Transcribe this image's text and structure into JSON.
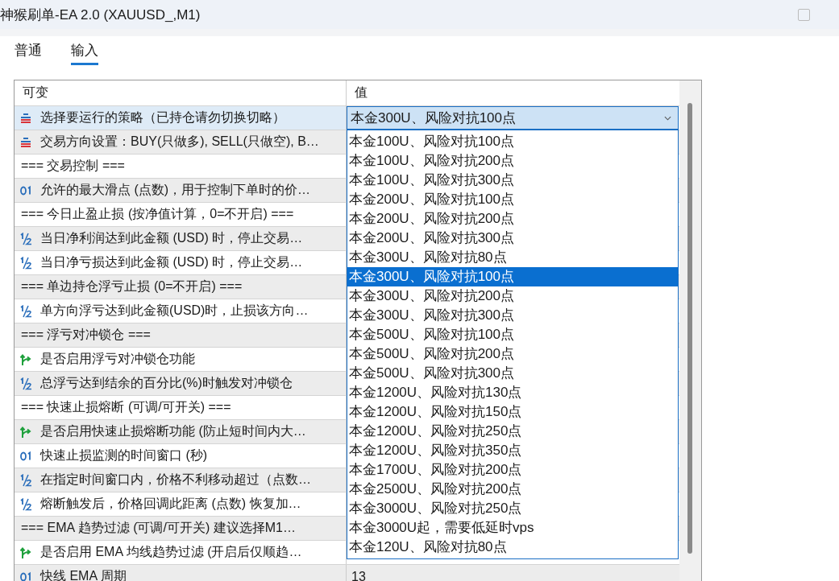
{
  "window": {
    "title": "神猴刷单-EA 2.0 (XAUUSD_,M1)"
  },
  "tabs": [
    {
      "label": "普通",
      "selected": false
    },
    {
      "label": "输入",
      "selected": true
    }
  ],
  "table": {
    "columns": [
      "可变",
      "值"
    ],
    "rows": [
      {
        "kind": "enum",
        "name": "选择要运行的策略（已持仓请勿切换切略）",
        "selected": true,
        "value": "本金300U、风险对抗100点"
      },
      {
        "kind": "enum",
        "name": "交易方向设置：BUY(只做多), SELL(只做空), B…",
        "selected": false
      },
      {
        "kind": "section",
        "name": "=== 交易控制 ===",
        "selected": false
      },
      {
        "kind": "int",
        "name": "允许的最大滑点 (点数)，用于控制下单时的价…",
        "selected": false
      },
      {
        "kind": "section",
        "name": "=== 今日止盈止损 (按净值计算，0=不开启) ===",
        "selected": false
      },
      {
        "kind": "double",
        "name": "当日净利润达到此金额 (USD) 时，停止交易…",
        "selected": false
      },
      {
        "kind": "double",
        "name": "当日净亏损达到此金额 (USD) 时，停止交易…",
        "selected": false
      },
      {
        "kind": "section",
        "name": "=== 单边持仓浮亏止损 (0=不开启) ===",
        "selected": false
      },
      {
        "kind": "double",
        "name": "单方向浮亏达到此金额(USD)时，止损该方向…",
        "selected": false
      },
      {
        "kind": "section",
        "name": "=== 浮亏对冲锁仓 ===",
        "selected": false
      },
      {
        "kind": "bool",
        "name": "是否启用浮亏对冲锁仓功能",
        "selected": false
      },
      {
        "kind": "double",
        "name": "总浮亏达到结余的百分比(%)时触发对冲锁仓",
        "selected": false
      },
      {
        "kind": "section",
        "name": "=== 快速止损熔断 (可调/可开关) ===",
        "selected": false
      },
      {
        "kind": "bool",
        "name": "是否启用快速止损熔断功能 (防止短时间内大…",
        "selected": false
      },
      {
        "kind": "int",
        "name": "快速止损监测的时间窗口 (秒)",
        "selected": false
      },
      {
        "kind": "double",
        "name": "在指定时间窗口内，价格不利移动超过（点数…",
        "selected": false
      },
      {
        "kind": "double",
        "name": "熔断触发后，价格回调此距离 (点数) 恢复加…",
        "selected": false
      },
      {
        "kind": "section",
        "name": "===  EMA 趋势过滤 (可调/可开关) 建议选择M1…",
        "selected": false
      },
      {
        "kind": "bool",
        "name": "是否启用 EMA 均线趋势过滤 (开启后仅顺趋…",
        "selected": false
      },
      {
        "kind": "int",
        "name": "快线 EMA 周期",
        "selected": false,
        "value": "13"
      }
    ]
  },
  "dropdown": {
    "options": [
      {
        "label": "本金100U、风险对抗100点",
        "selected": false
      },
      {
        "label": "本金100U、风险对抗200点",
        "selected": false
      },
      {
        "label": "本金100U、风险对抗300点",
        "selected": false
      },
      {
        "label": "本金200U、风险对抗100点",
        "selected": false
      },
      {
        "label": "本金200U、风险对抗200点",
        "selected": false
      },
      {
        "label": "本金200U、风险对抗300点",
        "selected": false
      },
      {
        "label": "本金300U、风险对抗80点",
        "selected": false
      },
      {
        "label": "本金300U、风险对抗100点",
        "selected": true
      },
      {
        "label": "本金300U、风险对抗200点",
        "selected": false
      },
      {
        "label": "本金300U、风险对抗300点",
        "selected": false
      },
      {
        "label": "本金500U、风险对抗100点",
        "selected": false
      },
      {
        "label": "本金500U、风险对抗200点",
        "selected": false
      },
      {
        "label": "本金500U、风险对抗300点",
        "selected": false
      },
      {
        "label": "本金1200U、风险对抗130点",
        "selected": false
      },
      {
        "label": "本金1200U、风险对抗150点",
        "selected": false
      },
      {
        "label": "本金1200U、风险对抗250点",
        "selected": false
      },
      {
        "label": "本金1200U、风险对抗350点",
        "selected": false
      },
      {
        "label": "本金1700U、风险对抗200点",
        "selected": false
      },
      {
        "label": "本金2500U、风险对抗200点",
        "selected": false
      },
      {
        "label": "本金3000U、风险对抗250点",
        "selected": false
      },
      {
        "label": "本金3000U起，需要低延时vps",
        "selected": false
      },
      {
        "label": "本金120U、风险对抗80点",
        "selected": false
      }
    ]
  }
}
